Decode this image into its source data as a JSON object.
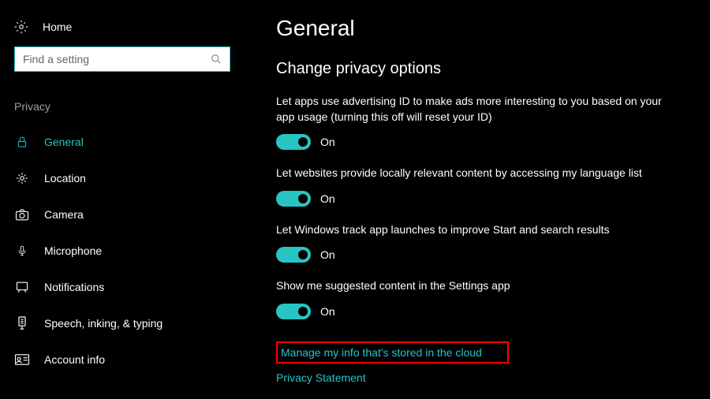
{
  "sidebar": {
    "home_label": "Home",
    "search_placeholder": "Find a setting",
    "section_label": "Privacy",
    "items": [
      {
        "label": "General",
        "icon": "lock-icon",
        "active": true
      },
      {
        "label": "Location",
        "icon": "location-icon",
        "active": false
      },
      {
        "label": "Camera",
        "icon": "camera-icon",
        "active": false
      },
      {
        "label": "Microphone",
        "icon": "microphone-icon",
        "active": false
      },
      {
        "label": "Notifications",
        "icon": "notifications-icon",
        "active": false
      },
      {
        "label": "Speech, inking, & typing",
        "icon": "speech-icon",
        "active": false
      },
      {
        "label": "Account info",
        "icon": "account-icon",
        "active": false
      }
    ]
  },
  "main": {
    "title": "General",
    "heading": "Change privacy options",
    "settings": [
      {
        "desc": "Let apps use advertising ID to make ads more interesting to you based on your app usage (turning this off will reset your ID)",
        "state": "On"
      },
      {
        "desc": "Let websites provide locally relevant content by accessing my language list",
        "state": "On"
      },
      {
        "desc": "Let Windows track app launches to improve Start and search results",
        "state": "On"
      },
      {
        "desc": "Show me suggested content in the Settings app",
        "state": "On"
      }
    ],
    "link_manage": "Manage my info that's stored in the cloud",
    "link_privacy": "Privacy Statement"
  },
  "colors": {
    "accent": "#28c4c4",
    "highlight": "#ff0000"
  }
}
